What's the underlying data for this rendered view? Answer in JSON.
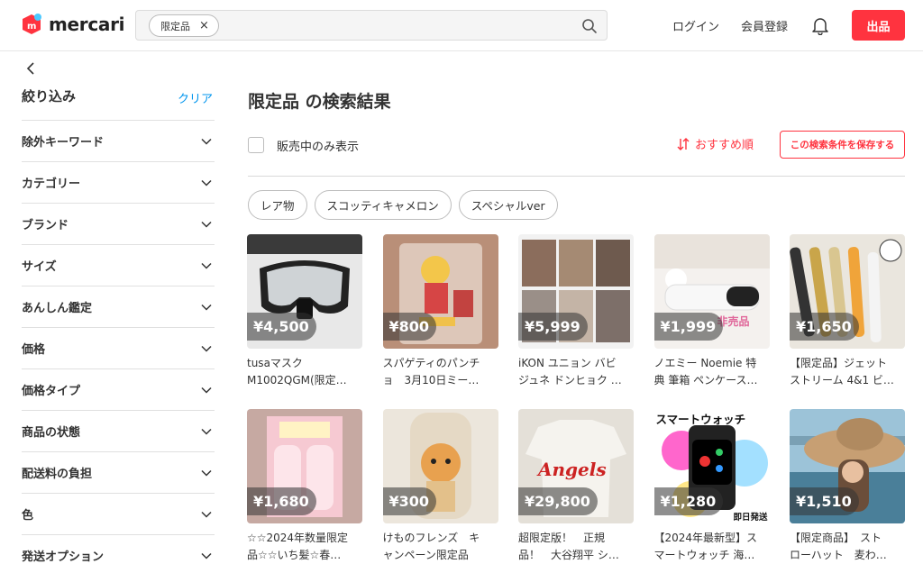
{
  "header": {
    "logo_text": "mercari",
    "search_chip": "限定品",
    "chip_close": "×",
    "login": "ログイン",
    "signup": "会員登録",
    "sell": "出品",
    "brand_color": "#ff333f"
  },
  "sidebar": {
    "title": "絞り込み",
    "clear": "クリア",
    "filters": [
      "除外キーワード",
      "カテゴリー",
      "ブランド",
      "サイズ",
      "あんしん鑑定",
      "価格",
      "価格タイプ",
      "商品の状態",
      "配送料の負担",
      "色",
      "発送オプション"
    ]
  },
  "main": {
    "title": "限定品 の検索結果",
    "onsale_label": "販売中のみ表示",
    "sort_label": "おすすめ順",
    "save_label": "この検索条件を保存する",
    "tags": [
      "レア物",
      "スコッティキャメロン",
      "スペシャルver"
    ],
    "items": [
      {
        "price": "¥4,500",
        "line1": "tusaマスク",
        "line2": "M1002QGM(限定…",
        "image": "diving-mask"
      },
      {
        "price": "¥800",
        "line1": "スパゲティのパンチ",
        "line2": "ョ　3月10日ミー…",
        "image": "acrylic-stand"
      },
      {
        "price": "¥5,999",
        "line1": "iKON ユニョン バビ",
        "line2": "ジュネ ドンヒョク …",
        "image": "photo-cards"
      },
      {
        "price": "¥1,999",
        "line1": "ノエミー Noemie 特",
        "line2": "典 筆箱 ペンケース…",
        "image": "pen-case",
        "overlay": "非売品"
      },
      {
        "price": "¥1,650",
        "line1": "【限定品】ジェット",
        "line2": "ストリーム 4&1 ビ…",
        "image": "pens"
      },
      {
        "price": "¥1,680",
        "line1": "☆☆2024年数量限定",
        "line2": "品☆☆いち髪☆春…",
        "image": "shampoo"
      },
      {
        "price": "¥300",
        "line1": "けものフレンズ　キ",
        "line2": "ャンペーン限定品",
        "image": "keychain"
      },
      {
        "price": "¥29,800",
        "line1": "超限定版！　正規",
        "line2": "品！　大谷翔平 シ…",
        "image": "jersey",
        "overlay": "Angels"
      },
      {
        "price": "¥1,280",
        "line1": "【2024年最新型】ス",
        "line2": "マートウォッチ 海…",
        "image": "smartwatch",
        "overlay": "スマートウォッチ",
        "overlay2": "即日発送"
      },
      {
        "price": "¥1,510",
        "line1": "【限定商品】　スト",
        "line2": "ローハット　麦わ…",
        "image": "straw-hat"
      }
    ]
  }
}
